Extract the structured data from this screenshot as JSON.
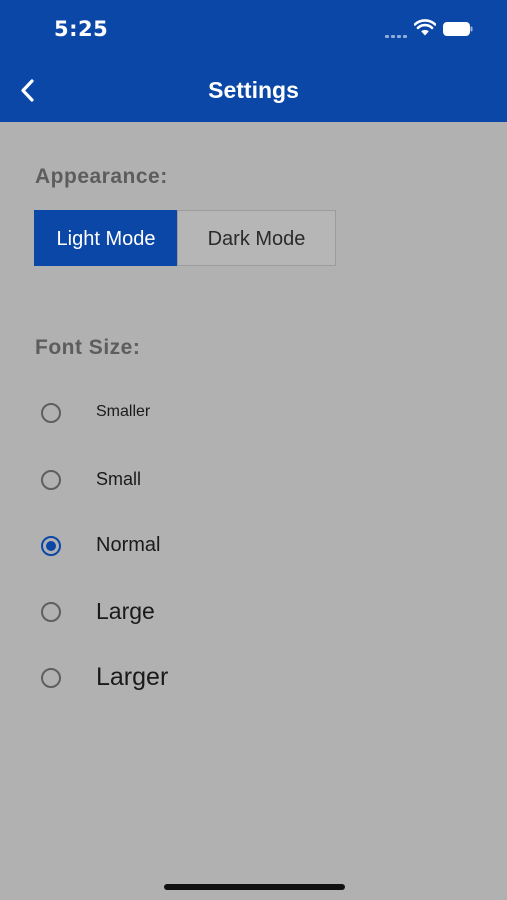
{
  "status_bar": {
    "time": "5:25"
  },
  "header": {
    "title": "Settings",
    "background": "#0b47a6"
  },
  "appearance": {
    "label": "Appearance:",
    "options": [
      "Light Mode",
      "Dark Mode"
    ],
    "selected": "Light Mode"
  },
  "font_size": {
    "label": "Font Size:",
    "options": [
      "Smaller",
      "Small",
      "Normal",
      "Large",
      "Larger"
    ],
    "selected": "Normal"
  },
  "colors": {
    "accent": "#0b47a6",
    "background": "#b1b1b1"
  },
  "icons": {
    "back": "chevron-left-icon",
    "wifi": "wifi-icon",
    "battery": "battery-icon",
    "signal": "signal-icon"
  }
}
